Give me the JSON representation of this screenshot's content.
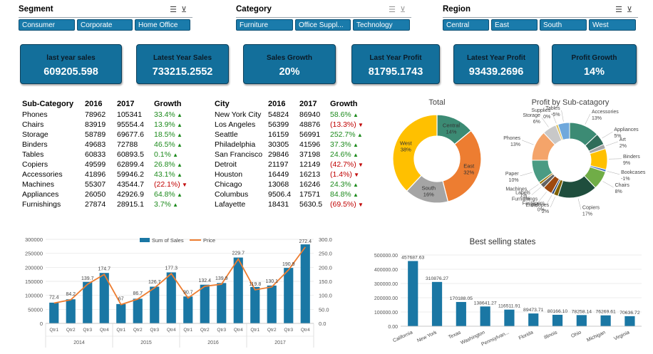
{
  "slicers": {
    "segment": {
      "title": "Segment",
      "items": [
        "Consumer",
        "Corporate",
        "Home Office"
      ]
    },
    "category": {
      "title": "Category",
      "items": [
        "Furniture",
        "Office Suppl...",
        "Technology"
      ]
    },
    "region": {
      "title": "Region",
      "items": [
        "Central",
        "East",
        "South",
        "West"
      ]
    }
  },
  "cards": [
    {
      "label": "last year sales",
      "value": "609205.598"
    },
    {
      "label": "Latest Year Sales",
      "value": "733215.2552"
    },
    {
      "label": "Sales Growth",
      "value": "20%"
    },
    {
      "label": "Last Year Profit",
      "value": "81795.1743"
    },
    {
      "label": "Latest Year Profit",
      "value": "93439.2696"
    },
    {
      "label": "Profit Growth",
      "value": "14%"
    }
  ],
  "subcategory_table": {
    "headers": [
      "Sub-Category",
      "2016",
      "2017",
      "Growth"
    ],
    "rows": [
      [
        "Phones",
        "78962",
        "105341",
        "33.4%",
        "up"
      ],
      [
        "Chairs",
        "83919",
        "95554.4",
        "13.9%",
        "up"
      ],
      [
        "Storage",
        "58789",
        "69677.6",
        "18.5%",
        "up"
      ],
      [
        "Binders",
        "49683",
        "72788",
        "46.5%",
        "up"
      ],
      [
        "Tables",
        "60833",
        "60893.5",
        "0.1%",
        "up"
      ],
      [
        "Copiers",
        "49599",
        "62899.4",
        "26.8%",
        "up"
      ],
      [
        "Accessories",
        "41896",
        "59946.2",
        "43.1%",
        "up"
      ],
      [
        "Machines",
        "55307",
        "43544.7",
        "(22.1%)",
        "down"
      ],
      [
        "Appliances",
        "26050",
        "42926.9",
        "64.8%",
        "up"
      ],
      [
        "Furnishings",
        "27874",
        "28915.1",
        "3.7%",
        "up"
      ]
    ]
  },
  "city_table": {
    "headers": [
      "City",
      "2016",
      "2017",
      "Growth"
    ],
    "rows": [
      [
        "New York City",
        "54824",
        "86940",
        "58.6%",
        "up"
      ],
      [
        "Los Angeles",
        "56399",
        "48876",
        "(13.3%)",
        "down"
      ],
      [
        "Seattle",
        "16159",
        "56991",
        "252.7%",
        "up"
      ],
      [
        "Philadelphia",
        "30305",
        "41596",
        "37.3%",
        "up"
      ],
      [
        "San Francisco",
        "29846",
        "37198",
        "24.6%",
        "up"
      ],
      [
        "Detroit",
        "21197",
        "12149",
        "(42.7%)",
        "down"
      ],
      [
        "Houston",
        "16449",
        "16213",
        "(1.4%)",
        "down"
      ],
      [
        "Chicago",
        "13068",
        "16246",
        "24.3%",
        "up"
      ],
      [
        "Columbus",
        "9506.4",
        "17571",
        "84.8%",
        "up"
      ],
      [
        "Lafayette",
        "18431",
        "5630.5",
        "(69.5%)",
        "down"
      ]
    ]
  },
  "chart_data": [
    {
      "type": "pie",
      "title": "Total",
      "slices": [
        {
          "name": "Central",
          "label": "14%",
          "value": 14,
          "color": "#3c8b74"
        },
        {
          "name": "East",
          "label": "32%",
          "value": 32,
          "color": "#ed7d31"
        },
        {
          "name": "South",
          "label": "16%",
          "value": 16,
          "color": "#a5a5a5"
        },
        {
          "name": "West",
          "label": "38%",
          "value": 38,
          "color": "#ffc000"
        }
      ]
    },
    {
      "type": "pie",
      "title": "Profit by Sub-catagory",
      "slices": [
        {
          "name": "Accessories",
          "label": "13%",
          "value": 13,
          "color": "#3c8b74"
        },
        {
          "name": "Appliances",
          "label": "5%",
          "value": 5,
          "color": "#2f6d5a"
        },
        {
          "name": "Art",
          "label": "2%",
          "value": 2,
          "color": "#a5a5a5"
        },
        {
          "name": "Binders",
          "label": "9%",
          "value": 9,
          "color": "#ffc000"
        },
        {
          "name": "Bookcases",
          "label": "-1%",
          "value": 1,
          "color": "#4472c4"
        },
        {
          "name": "Chairs",
          "label": "8%",
          "value": 8,
          "color": "#70ad47"
        },
        {
          "name": "Copiers",
          "label": "17%",
          "value": 17,
          "color": "#1f4e3d"
        },
        {
          "name": "Envelopes",
          "label": "2%",
          "value": 2,
          "color": "#7f6000"
        },
        {
          "name": "Fasteners",
          "label": "0%",
          "value": 1,
          "color": "#264478"
        },
        {
          "name": "Furnishings",
          "label": "4%",
          "value": 4,
          "color": "#9e480e"
        },
        {
          "name": "Labels",
          "label": "2%",
          "value": 2,
          "color": "#636363"
        },
        {
          "name": "Machines",
          "label": "1%",
          "value": 1,
          "color": "#997300"
        },
        {
          "name": "Paper",
          "label": "10%",
          "value": 10,
          "color": "#4a9b83"
        },
        {
          "name": "Phones",
          "label": "13%",
          "value": 13,
          "color": "#f4a46a"
        },
        {
          "name": "Storage",
          "label": "6%",
          "value": 6,
          "color": "#c8c8c8"
        },
        {
          "name": "Supplies",
          "label": "0%",
          "value": 1,
          "color": "#e0c25a"
        },
        {
          "name": "Tables",
          "label": "-5%",
          "value": 5,
          "color": "#6fa8dc"
        }
      ]
    },
    {
      "type": "bar",
      "legend": [
        "Sum of Sales",
        "Price"
      ],
      "quarters": [
        "Qtr1",
        "Qtr2",
        "Qtr3",
        "Qtr4",
        "Qtr1",
        "Qtr2",
        "Qtr3",
        "Qtr4",
        "Qtr1",
        "Qtr2",
        "Qtr3",
        "Qtr4",
        "Qtr1",
        "Qtr2",
        "Qtr3",
        "Qtr4"
      ],
      "years": [
        "2014",
        "2015",
        "2016",
        "2017"
      ],
      "series": [
        {
          "name": "Sum of Sales",
          "axis": "left",
          "values": [
            74000,
            86000,
            148000,
            180000,
            69000,
            88000,
            131000,
            182000,
            96000,
            138000,
            144000,
            235000,
            130000,
            135000,
            198000,
            282000
          ]
        },
        {
          "name": "Price",
          "axis": "right",
          "values": [
            72.4,
            84.2,
            139.7,
            174.7,
            67.0,
            86.7,
            126.7,
            177.3,
            90.7,
            132.4,
            139.9,
            229.7,
            119.8,
            130.1,
            190.9,
            272.4
          ]
        }
      ],
      "ylim_left": [
        0,
        300000
      ],
      "ylim_right": [
        0,
        300
      ],
      "left_ticks": [
        "0",
        "50000",
        "100000",
        "150000",
        "200000",
        "250000",
        "300000"
      ],
      "right_ticks": [
        "0.0",
        "50.0",
        "100.0",
        "150.0",
        "200.0",
        "250.0",
        "300.0"
      ]
    },
    {
      "type": "bar",
      "title": "Best selling states",
      "categories": [
        "California",
        "New York",
        "Texas",
        "Washington",
        "Pennsylvan...",
        "Florida",
        "Illinois",
        "Ohio",
        "Michigan",
        "Virginia"
      ],
      "values": [
        457687.63,
        310876.27,
        170188.05,
        138641.27,
        116511.91,
        89473.71,
        80166.1,
        78258.14,
        76269.61,
        70636.72
      ],
      "value_labels": [
        "457687.63",
        "310876.27",
        "170188.05",
        "138641.27",
        "116511.91",
        "89473.71",
        "80166.10",
        "78258.14",
        "76269.61",
        "70636.72"
      ],
      "ylim": [
        0,
        500000
      ],
      "ticks": [
        "0.00",
        "100000.00",
        "200000.00",
        "300000.00",
        "400000.00",
        "500000.00"
      ]
    }
  ]
}
